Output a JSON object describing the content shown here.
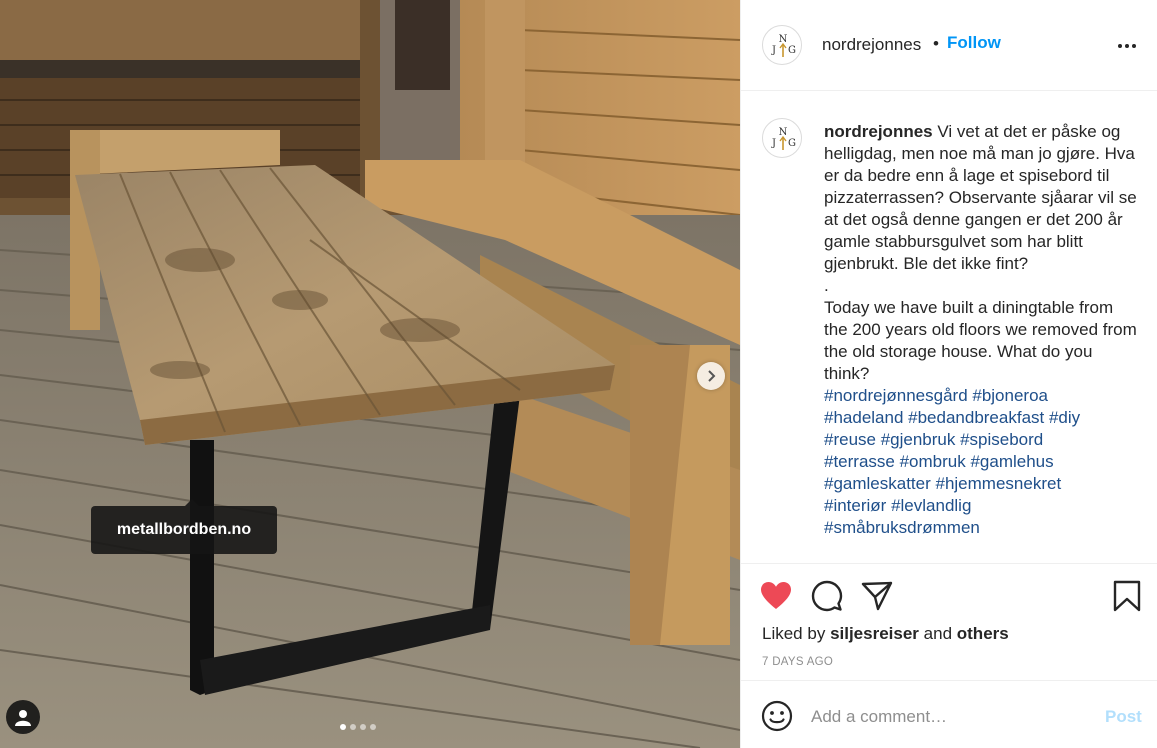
{
  "post": {
    "image_tag": "metallbordben.no",
    "carousel": {
      "count": 4,
      "active_index": 0
    }
  },
  "header": {
    "username": "nordrejonnes",
    "separator": "•",
    "follow_label": "Follow"
  },
  "caption": {
    "username": "nordrejonnes",
    "text": "Vi vet at det er påske og helligdag, men noe må man jo gjøre. Hva er da bedre enn å lage et spisebord til pizzaterrassen? Observante sjåarar vil se at det også denne gangen er det 200 år gamle stabbursgulvet som har blitt gjenbrukt. Ble det ikke fint?\n.\nToday we have built a diningtable from the 200 years old floors we removed from the old storage house. What do you think?",
    "hashtags": "#nordrejønnesgård #bjoneroa\n#hadeland #bedandbreakfast #diy\n#reuse #gjenbruk #spisebord\n#terrasse #ombruk #gamlehus\n#gamleskatter #hjemmesnekret\n#interiør #levlandlig\n#småbruksdrømmen"
  },
  "actions": {
    "liked_by_prefix": "Liked by",
    "liked_by_user": "siljesreiser",
    "liked_by_and": "and",
    "liked_by_others": "others",
    "time_ago": "7 DAYS AGO",
    "like_color": "#ed4956"
  },
  "comment": {
    "placeholder": "Add a comment…",
    "post_label": "Post"
  }
}
